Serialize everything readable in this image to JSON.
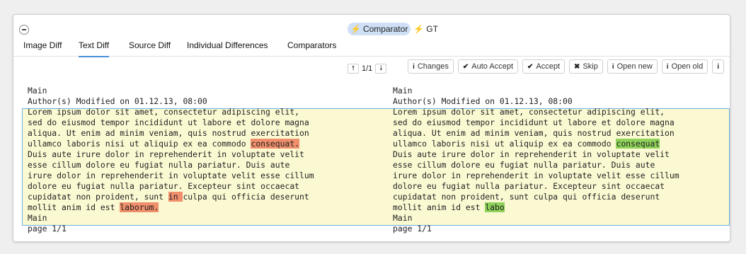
{
  "header": {
    "comparator_label": "Comparator",
    "gt_label": "GT"
  },
  "tabs": [
    "Image Diff",
    "Text Diff",
    "Source Diff",
    "Individual Differences",
    "Comparators"
  ],
  "toolbar": {
    "changes": "Changes",
    "auto_accept": "Auto Accept",
    "accept": "Accept",
    "skip": "Skip",
    "open_new": "Open new",
    "open_old": "Open old"
  },
  "pager": {
    "label": "1/1"
  },
  "left": {
    "header1": "Main",
    "header2": "Author(s) Modified on 01.12.13, 08:00",
    "l1": "Lorem ipsum dolor sit amet, consectetur adipiscing elit,",
    "l2": "sed do eiusmod tempor incididunt ut labore et dolore magna",
    "l3": "aliqua. Ut enim ad minim veniam, quis nostrud exercitation",
    "l4a": "ullamco laboris nisi ut aliquip ex ea commodo ",
    "l4b": "consequat.",
    "l5": "Duis aute irure dolor in reprehenderit in voluptate velit",
    "l6": "esse cillum dolore eu fugiat nulla pariatur. Duis aute",
    "l7": "irure dolor in reprehenderit in voluptate velit esse cillum",
    "l8": "dolore eu fugiat nulla pariatur. Excepteur sint occaecat",
    "l9a": "cupidatat non proident, sunt ",
    "l9b": "in ",
    "l9c": "culpa qui officia deserunt",
    "l10a": "mollit anim id est ",
    "l10b": "laborum.",
    "footer1": "Main",
    "footer2": "page 1/1"
  },
  "right": {
    "header1": "Main",
    "header2": "Author(s) Modified on 01.12.13, 08:00",
    "l1": "Lorem ipsum dolor sit amet, consectetur adipiscing elit,",
    "l2": "sed do eiusmod tempor incididunt ut labore et dolore magna",
    "l3": "aliqua. Ut enim ad minim veniam, quis nostrud exercitation",
    "l4a": "ullamco laboris nisi ut aliquip ex ea commodo ",
    "l4b": "consequat",
    "l5": "Duis aute irure dolor in reprehenderit in voluptate velit",
    "l6": "esse cillum dolore eu fugiat nulla pariatur. Duis aute",
    "l7": "irure dolor in reprehenderit in voluptate velit esse cillum",
    "l8": "dolore eu fugiat nulla pariatur. Excepteur sint occaecat",
    "l9": "cupidatat non proident, sunt culpa qui officia deserunt",
    "l10a": "mollit anim id est ",
    "l10b": "labo",
    "footer1": "Main",
    "footer2": "page 1/1"
  },
  "colors": {
    "deleted": "#ef8f6c",
    "inserted": "#8fd25a",
    "changed_bg": "#fbf9d2",
    "accent": "#4a90d9"
  }
}
